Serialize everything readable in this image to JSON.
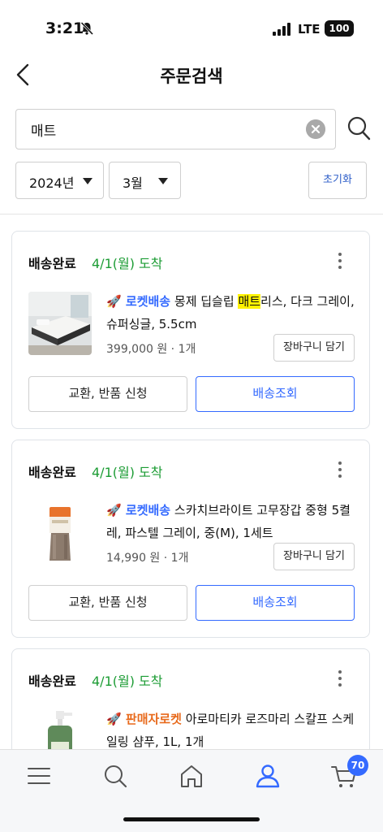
{
  "status_bar": {
    "time": "3:21",
    "network": "LTE",
    "battery": "100"
  },
  "header": {
    "title": "주문검색"
  },
  "search": {
    "value": "매트",
    "placeholder": ""
  },
  "filters": {
    "year": "2024년",
    "month": "3월",
    "reset_label": "초기화"
  },
  "orders": [
    {
      "status": "배송완료",
      "arrival": "4/1(월) 도착",
      "badge": "🚀 로켓배송",
      "title_before": "몽제 딥슬립 ",
      "title_highlight": "매트",
      "title_after": "리스, 다크 그레이, 슈퍼싱글, 5.5cm",
      "price": "399,000 원 · 1개",
      "cart_label": "장바구니 담기",
      "return_label": "교환, 반품 신청",
      "track_label": "배송조회",
      "image": "mattress-photo"
    },
    {
      "status": "배송완료",
      "arrival": "4/1(월) 도착",
      "badge": "🚀 로켓배송",
      "title": "스카치브라이트 고무장갑 중형 5켤레, 파스텔 그레이, 중(M), 1세트",
      "price": "14,990 원 · 1개",
      "cart_label": "장바구니 담기",
      "return_label": "교환, 반품 신청",
      "track_label": "배송조회",
      "image": "rubber-gloves-photo"
    },
    {
      "status": "배송완료",
      "arrival": "4/1(월) 도착",
      "badge": "🚀 판매자로켓",
      "title": "아로마티카 로즈마리 스칼프 스케일링 샴푸, 1L, 1개",
      "image": "shampoo-bottle-photo"
    }
  ],
  "tabbar": {
    "items": [
      "menu-icon",
      "search-icon",
      "home-icon",
      "my-page-icon",
      "cart-icon"
    ],
    "cart_count": "70",
    "active_color": "#346aff"
  },
  "colors": {
    "accent": "#346aff",
    "arrival_green": "#1c9c34",
    "seller_rocket": "#e86a1c",
    "highlight": "#fff200"
  }
}
